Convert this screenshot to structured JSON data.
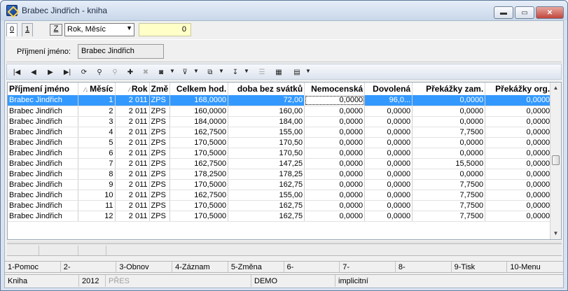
{
  "window": {
    "title": "Brabec Jindřich - kniha"
  },
  "topbar": {
    "tabs": [
      "0",
      "1"
    ],
    "z_button": "Z",
    "period_select": "Rok, Měsíc",
    "value": "0"
  },
  "filter": {
    "label": "Příjmení jméno:",
    "value": "Brabec Jindřich"
  },
  "toolbar": {
    "icons": [
      "first-record-icon",
      "prev-record-icon",
      "next-record-icon",
      "last-record-icon",
      "refresh-icon",
      "find-icon",
      "binoculars-disabled-icon",
      "add-record-icon",
      "delete-record-icon",
      "camera-icon",
      "filter-icon",
      "export-icon",
      "sort-icon",
      "indent-icon",
      "excel-icon",
      "columns-icon"
    ]
  },
  "grid": {
    "columns": [
      "Příjmení jméno",
      "Měsíc",
      "Rok",
      "Změ",
      "Celkem hod.",
      "doba bez svátků",
      "Nemocenská",
      "Dovolená",
      "Překážky zam.",
      "Překážky org."
    ],
    "rows": [
      [
        "Brabec Jindřich",
        "1",
        "2 011",
        "ZPS",
        "168,0000",
        "72,00",
        "0,0000",
        "96,0...",
        "0,0000",
        "0,0000"
      ],
      [
        "Brabec Jindřich",
        "2",
        "2 011",
        "ZPS",
        "160,0000",
        "160,00",
        "0,0000",
        "0,0000",
        "0,0000",
        "0,0000"
      ],
      [
        "Brabec Jindřich",
        "3",
        "2 011",
        "ZPS",
        "184,0000",
        "184,00",
        "0,0000",
        "0,0000",
        "0,0000",
        "0,0000"
      ],
      [
        "Brabec Jindřich",
        "4",
        "2 011",
        "ZPS",
        "162,7500",
        "155,00",
        "0,0000",
        "0,0000",
        "7,7500",
        "0,0000"
      ],
      [
        "Brabec Jindřich",
        "5",
        "2 011",
        "ZPS",
        "170,5000",
        "170,50",
        "0,0000",
        "0,0000",
        "0,0000",
        "0,0000"
      ],
      [
        "Brabec Jindřich",
        "6",
        "2 011",
        "ZPS",
        "170,5000",
        "170,50",
        "0,0000",
        "0,0000",
        "0,0000",
        "0,0000"
      ],
      [
        "Brabec Jindřich",
        "7",
        "2 011",
        "ZPS",
        "162,7500",
        "147,25",
        "0,0000",
        "0,0000",
        "15,5000",
        "0,0000"
      ],
      [
        "Brabec Jindřich",
        "8",
        "2 011",
        "ZPS",
        "178,2500",
        "178,25",
        "0,0000",
        "0,0000",
        "0,0000",
        "0,0000"
      ],
      [
        "Brabec Jindřich",
        "9",
        "2 011",
        "ZPS",
        "170,5000",
        "162,75",
        "0,0000",
        "0,0000",
        "7,7500",
        "0,0000"
      ],
      [
        "Brabec Jindřich",
        "10",
        "2 011",
        "ZPS",
        "162,7500",
        "155,00",
        "0,0000",
        "0,0000",
        "7,7500",
        "0,0000"
      ],
      [
        "Brabec Jindřich",
        "11",
        "2 011",
        "ZPS",
        "170,5000",
        "162,75",
        "0,0000",
        "0,0000",
        "7,7500",
        "0,0000"
      ],
      [
        "Brabec Jindřich",
        "12",
        "2 011",
        "ZPS",
        "170,5000",
        "162,75",
        "0,0000",
        "0,0000",
        "7,7500",
        "0,0000"
      ]
    ],
    "selected_row": 0
  },
  "fkeys": [
    "1-Pomoc",
    "2-",
    "3-Obnov",
    "4-Záznam",
    "5-Změna",
    "6-",
    "7-",
    "8-",
    "9-Tisk",
    "10-Menu"
  ],
  "status": {
    "module": "Kniha",
    "year": "2012",
    "pres": "PŘES",
    "db": "DEMO",
    "mode": "implicitní"
  },
  "colors": {
    "selection": "#3399ff",
    "value_box": "#ffffc8"
  }
}
